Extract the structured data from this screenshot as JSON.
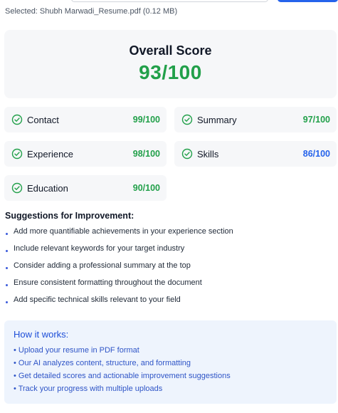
{
  "upload": {
    "selected_text": "Selected: Shubh Marwadi_Resume.pdf (0.12 MB)"
  },
  "overall": {
    "title": "Overall Score",
    "score": "93/100",
    "score_color": "#22a04a"
  },
  "categories": [
    {
      "label": "Contact",
      "score": "99/100",
      "color": "#22a04a",
      "icon": "check-circle-icon"
    },
    {
      "label": "Summary",
      "score": "97/100",
      "color": "#22a04a",
      "icon": "check-circle-icon"
    },
    {
      "label": "Experience",
      "score": "98/100",
      "color": "#22a04a",
      "icon": "check-circle-icon"
    },
    {
      "label": "Skills",
      "score": "86/100",
      "color": "#2563eb",
      "icon": "check-circle-icon"
    },
    {
      "label": "Education",
      "score": "90/100",
      "color": "#22a04a",
      "icon": "check-circle-icon"
    }
  ],
  "suggestions": {
    "title": "Suggestions for Improvement:",
    "items": [
      "Add more quantifiable achievements in your experience section",
      "Include relevant keywords for your target industry",
      "Consider adding a professional summary at the top",
      "Ensure consistent formatting throughout the document",
      "Add specific technical skills relevant to your field"
    ]
  },
  "how_it_works": {
    "title": "How it works:",
    "items": [
      "• Upload your resume in PDF format",
      "• Our AI analyzes content, structure, and formatting",
      "• Get detailed scores and actionable improvement suggestions",
      "• Track your progress with multiple uploads"
    ]
  },
  "colors": {
    "accent_green": "#22a04a",
    "accent_blue": "#2563eb",
    "info_panel": "#eef4fd",
    "card_bg": "#f6f7f9"
  }
}
